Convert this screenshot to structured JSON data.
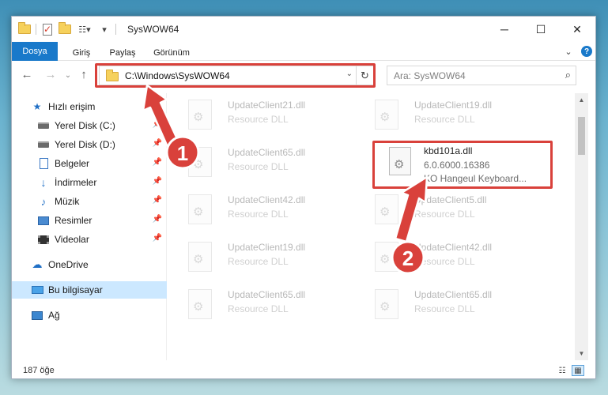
{
  "window": {
    "title": "SysWOW64",
    "controls": {
      "minimize": "─",
      "maximize": "☐",
      "close": "✕"
    }
  },
  "ribbon": {
    "tabs": [
      {
        "label": "Dosya"
      },
      {
        "label": "Giriş"
      },
      {
        "label": "Paylaş"
      },
      {
        "label": "Görünüm"
      }
    ],
    "help": "?"
  },
  "navbar": {
    "address": "C:\\Windows\\SysWOW64",
    "search_placeholder": "Ara: SysWOW64"
  },
  "sidebar": {
    "items": [
      {
        "label": "Hızlı erişim",
        "icon": "star-icon"
      },
      {
        "label": "Yerel Disk (C:)",
        "icon": "drive-icon",
        "pinned": true
      },
      {
        "label": "Yerel Disk (D:)",
        "icon": "drive-icon",
        "pinned": true
      },
      {
        "label": "Belgeler",
        "icon": "document-icon",
        "pinned": true
      },
      {
        "label": "İndirmeler",
        "icon": "download-icon",
        "pinned": true
      },
      {
        "label": "Müzik",
        "icon": "music-icon",
        "pinned": true
      },
      {
        "label": "Resimler",
        "icon": "pictures-icon",
        "pinned": true
      },
      {
        "label": "Videolar",
        "icon": "videos-icon",
        "pinned": true
      },
      {
        "label": "OneDrive",
        "icon": "cloud-icon"
      },
      {
        "label": "Bu bilgisayar",
        "icon": "computer-icon",
        "selected": true
      },
      {
        "label": "Ağ",
        "icon": "network-icon"
      }
    ]
  },
  "files": [
    {
      "name": "UpdateClient21.dll",
      "type": "Resource DLL",
      "faded": true
    },
    {
      "name": "UpdateClient19.dll",
      "type": "Resource DLL",
      "faded": true
    },
    {
      "name": "UpdateClient65.dll",
      "type": "Resource DLL",
      "faded": true
    },
    {
      "name": "kbd101a.dll",
      "type": "6.0.6000.16386",
      "desc": "KO Hangeul Keyboard...",
      "faded": false,
      "highlighted": true
    },
    {
      "name": "UpdateClient42.dll",
      "type": "Resource DLL",
      "faded": true
    },
    {
      "name": "UpdateClient5.dll",
      "type": "Resource DLL",
      "faded": true
    },
    {
      "name": "UpdateClient19.dll",
      "type": "Resource DLL",
      "faded": true
    },
    {
      "name": "UpdateClient42.dll",
      "type": "Resource DLL",
      "faded": true
    },
    {
      "name": "UpdateClient65.dll",
      "type": "Resource DLL",
      "faded": true
    },
    {
      "name": "UpdateClient65.dll",
      "type": "Resource DLL",
      "faded": true
    }
  ],
  "status": {
    "count": "187 öğe"
  },
  "callouts": [
    {
      "number": "1",
      "color": "#d9413b"
    },
    {
      "number": "2",
      "color": "#d9413b"
    }
  ]
}
